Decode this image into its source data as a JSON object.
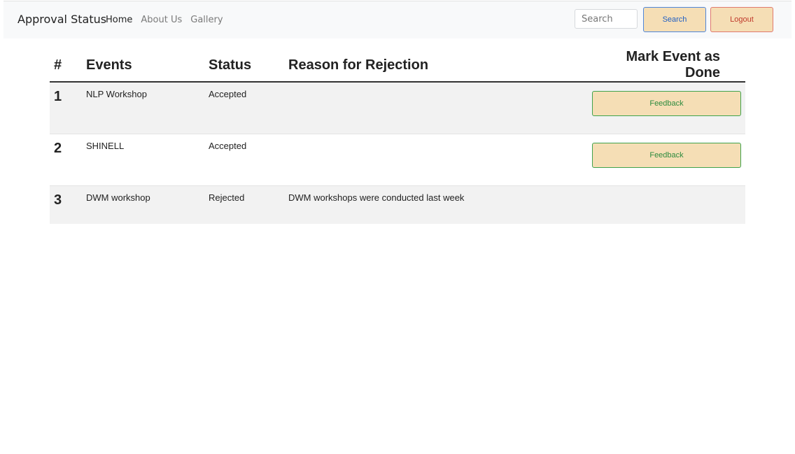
{
  "navbar": {
    "brand": "Approval Status",
    "links": [
      "Home",
      "About Us",
      "Gallery"
    ],
    "search_placeholder": "Search",
    "search_button": "Search",
    "logout_button": "Logout"
  },
  "table": {
    "headers": {
      "num": "#",
      "events": "Events",
      "status": "Status",
      "reason": "Reason for Rejection",
      "mark": "Mark Event as Done"
    },
    "rows": [
      {
        "num": "1",
        "event": "NLP Workshop",
        "status": "Accepted",
        "reason": "",
        "action": "Feedback"
      },
      {
        "num": "2",
        "event": "SHINELL",
        "status": "Accepted",
        "reason": "",
        "action": "Feedback"
      },
      {
        "num": "3",
        "event": "DWM workshop",
        "status": "Rejected",
        "reason": "DWM workshops were conducted last week",
        "action": ""
      }
    ]
  },
  "colors": {
    "navbar_bg": "#f8f9fa",
    "button_bg": "#f5deb5",
    "search_border": "#4f86d9",
    "logout_border": "#e07a6e",
    "feedback_border": "#3fa34d",
    "stripe": "#f2f2f2"
  }
}
